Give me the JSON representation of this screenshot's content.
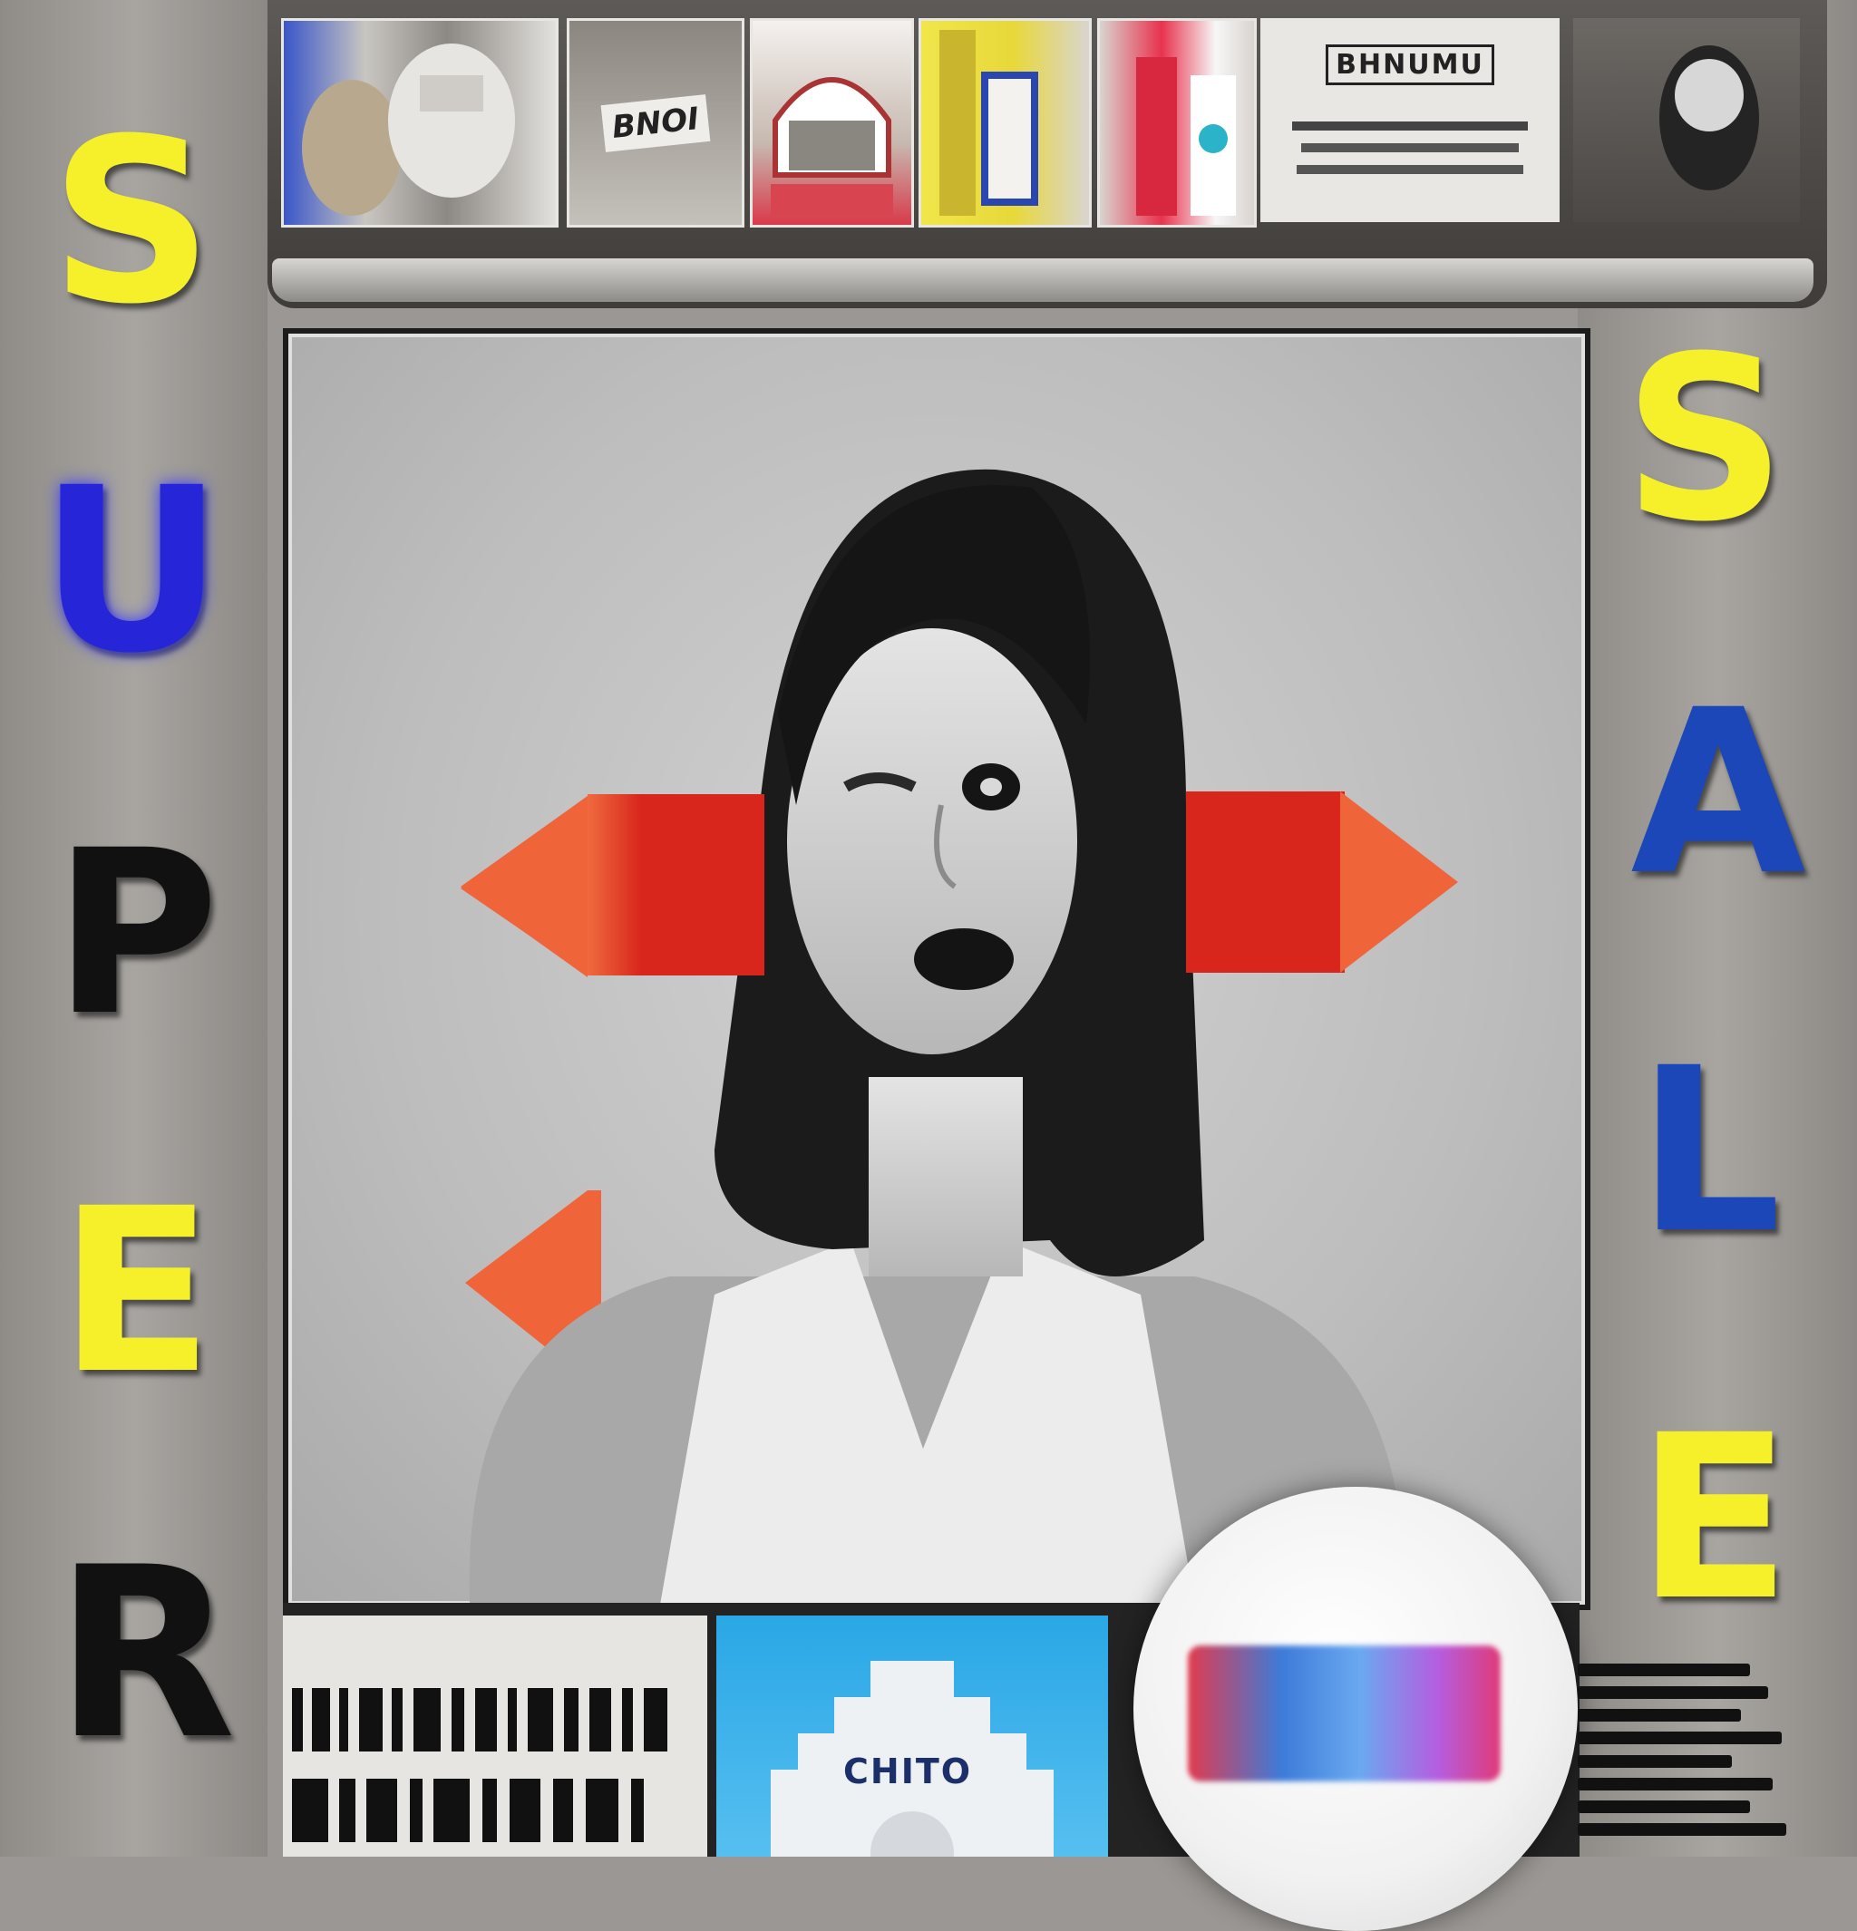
{
  "headline": {
    "left_letters": [
      "S",
      "U",
      "P",
      "E",
      "R"
    ],
    "right_letters": [
      "S",
      "A",
      "L",
      "E"
    ]
  },
  "shelf": {
    "labels": [
      "BNOI",
      "BHNUMU"
    ]
  },
  "bottom": {
    "tile_text": "CHITO"
  },
  "colors": {
    "yellow": "#f5f02a",
    "blue_bright": "#2626d8",
    "blue": "#1c47b8",
    "black": "#111111",
    "red": "#d8261d",
    "orange": "#f0643a"
  }
}
